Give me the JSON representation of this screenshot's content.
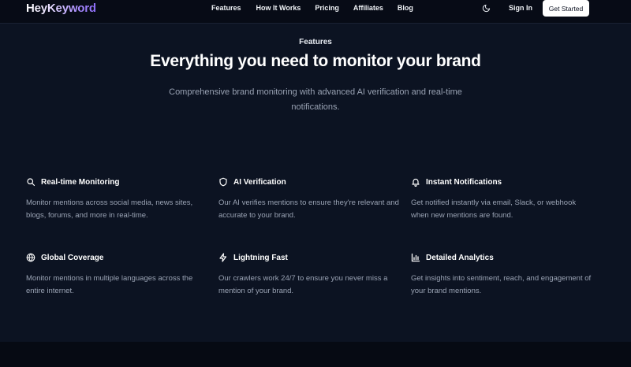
{
  "nav": {
    "logo": "HeyKeyword",
    "links": [
      "Features",
      "How It Works",
      "Pricing",
      "Affiliates",
      "Blog"
    ],
    "theme_icon": "moon-icon",
    "signin": "Sign In",
    "cta": "Get Started"
  },
  "hero": {
    "eyebrow": "Features",
    "headline": "Everything you need to monitor your brand",
    "subhead": "Comprehensive brand monitoring with advanced AI verification and real-time notifications."
  },
  "features": [
    {
      "icon": "search-icon",
      "title": "Real-time Monitoring",
      "desc": "Monitor mentions across social media, news sites, blogs, forums, and more in real-time."
    },
    {
      "icon": "shield-icon",
      "title": "AI Verification",
      "desc": "Our AI verifies mentions to ensure they're relevant and accurate to your brand."
    },
    {
      "icon": "bell-icon",
      "title": "Instant Notifications",
      "desc": "Get notified instantly via email, Slack, or webhook when new mentions are found."
    },
    {
      "icon": "globe-icon",
      "title": "Global Coverage",
      "desc": "Monitor mentions in multiple languages across the entire internet."
    },
    {
      "icon": "lightning-icon",
      "title": "Lightning Fast",
      "desc": "Our crawlers work 24/7 to ensure you never miss a mention of your brand."
    },
    {
      "icon": "bar-chart-icon",
      "title": "Detailed Analytics",
      "desc": "Get insights into sentiment, reach, and engagement of your brand mentions."
    }
  ],
  "colors": {
    "background": "#0c1322",
    "nav_background": "#070b16",
    "accent": "#8b6cf6",
    "text_muted": "#9aa3b4"
  }
}
